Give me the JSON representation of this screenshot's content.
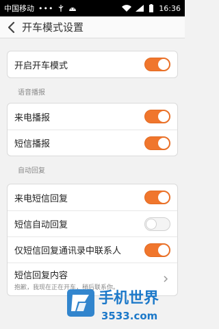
{
  "status": {
    "carrier": "中国移动",
    "dots": "•••",
    "time": "16:36"
  },
  "header": {
    "title": "开车模式设置"
  },
  "main": {
    "enable": {
      "label": "开启开车模式",
      "on": true
    },
    "voice_section": "语音播报",
    "voice_items": [
      {
        "label": "来电播报",
        "on": true
      },
      {
        "label": "短信播报",
        "on": true
      }
    ],
    "auto_section": "自动回复",
    "auto_items": [
      {
        "label": "来电短信回复",
        "on": true
      },
      {
        "label": "短信自动回复",
        "on": false
      },
      {
        "label": "仅短信回复通讯录中联系人",
        "on": true
      }
    ],
    "reply_content": {
      "label": "短信回复内容",
      "value": "抱歉，我现在正在开车，稍后联系你。"
    }
  },
  "colors": {
    "accent": "#f0762d",
    "watermark_blue": "#1d79c9"
  },
  "watermark": {
    "title": "手机世界",
    "domain": "3533.com"
  }
}
